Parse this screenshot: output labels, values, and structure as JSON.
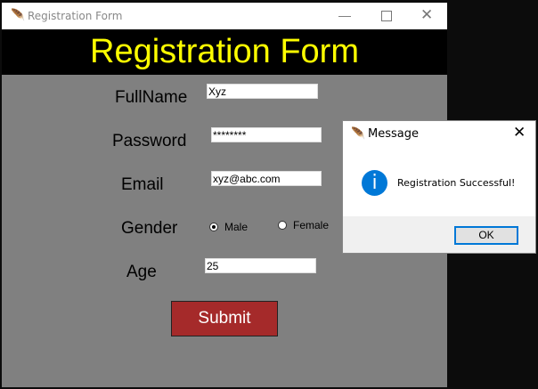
{
  "window": {
    "title": "Registration Form",
    "minimize_icon": "minimize-icon",
    "maximize_icon": "maximize-icon",
    "close_icon": "close-icon"
  },
  "header": {
    "title": "Registration Form",
    "bg": "#000000",
    "color": "#ffff00"
  },
  "form": {
    "fullname": {
      "label": "FullName",
      "value": "Xyz"
    },
    "password": {
      "label": "Password",
      "value": "********"
    },
    "email": {
      "label": "Email",
      "value": "xyz@abc.com"
    },
    "gender": {
      "label": "Gender",
      "options": [
        "Male",
        "Female"
      ],
      "selected": "Male"
    },
    "age": {
      "label": "Age",
      "value": "25"
    },
    "submit_label": "Submit",
    "submit_color": "#a52a2a"
  },
  "dialog": {
    "title": "Message",
    "message": "Registration Successful!",
    "ok_label": "OK",
    "icon": "info-icon"
  }
}
